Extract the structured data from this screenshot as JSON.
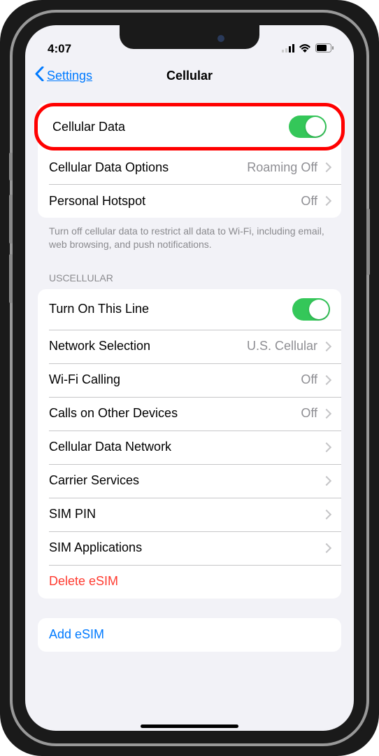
{
  "status": {
    "time": "4:07"
  },
  "nav": {
    "back": "Settings",
    "title": "Cellular"
  },
  "section1": {
    "cellular_data": "Cellular Data",
    "cellular_data_options": "Cellular Data Options",
    "cellular_data_options_value": "Roaming Off",
    "personal_hotspot": "Personal Hotspot",
    "personal_hotspot_value": "Off",
    "footer": "Turn off cellular data to restrict all data to Wi-Fi, including email, web browsing, and push notifications."
  },
  "section2": {
    "header": "USCELLULAR",
    "turn_on_line": "Turn On This Line",
    "network_selection": "Network Selection",
    "network_selection_value": "U.S. Cellular",
    "wifi_calling": "Wi-Fi Calling",
    "wifi_calling_value": "Off",
    "calls_other_devices": "Calls on Other Devices",
    "calls_other_devices_value": "Off",
    "cellular_data_network": "Cellular Data Network",
    "carrier_services": "Carrier Services",
    "sim_pin": "SIM PIN",
    "sim_applications": "SIM Applications",
    "delete_esim": "Delete eSIM"
  },
  "section3": {
    "add_esim": "Add eSIM"
  }
}
